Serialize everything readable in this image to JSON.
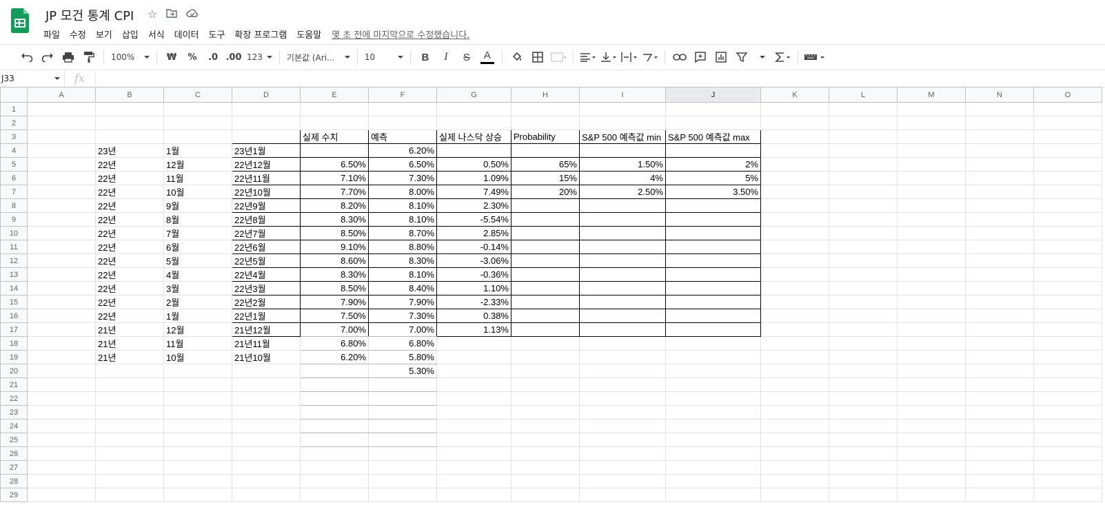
{
  "app": {
    "doc_title": "JP 모건 통계 CPI",
    "menu": [
      "파일",
      "수정",
      "보기",
      "삽입",
      "서식",
      "데이터",
      "도구",
      "확장 프로그램",
      "도움말"
    ],
    "last_edit": "몇 초 전에 마지막으로 수정했습니다.",
    "brand_color": "#0f9d58"
  },
  "toolbar": {
    "zoom": "100%",
    "currency": "₩",
    "percent": "%",
    "decimal_decrease": ".0",
    "decimal_increase": ".00",
    "format_more": "123",
    "font": "기본값 (Ari...",
    "font_size": "10",
    "bold": "B",
    "italic": "I",
    "strike": "S",
    "text_color": "A"
  },
  "formula_bar": {
    "cell_ref": "J33",
    "fx": "fx",
    "value": ""
  },
  "grid": {
    "columns": [
      "A",
      "B",
      "C",
      "D",
      "E",
      "F",
      "G",
      "H",
      "I",
      "J",
      "K",
      "L",
      "M",
      "N",
      "O"
    ],
    "selected_column": "J",
    "row_count": 29,
    "header_row": {
      "E": "실제 수치",
      "F": "예측",
      "G": "실제 나스닥 상승",
      "H": "Probability",
      "I": "S&P 500 예측값 min",
      "J": "S&P 500 예측값 max"
    },
    "rows": [
      {
        "B": "23년",
        "C": "1월",
        "D": "23년1월",
        "E": "",
        "F": "6.20%",
        "G": "",
        "H": "",
        "I": "",
        "J": ""
      },
      {
        "B": "22년",
        "C": "12월",
        "D": "22년12월",
        "E": "6.50%",
        "F": "6.50%",
        "G": "0.50%",
        "H": "65%",
        "I": "1.50%",
        "J": "2%"
      },
      {
        "B": "22년",
        "C": "11월",
        "D": "22년11월",
        "E": "7.10%",
        "F": "7.30%",
        "G": "1.09%",
        "H": "15%",
        "I": "4%",
        "J": "5%"
      },
      {
        "B": "22년",
        "C": "10월",
        "D": "22년10월",
        "E": "7.70%",
        "F": "8.00%",
        "G": "7.49%",
        "H": "20%",
        "I": "2.50%",
        "J": "3.50%"
      },
      {
        "B": "22년",
        "C": "9월",
        "D": "22년9월",
        "E": "8.20%",
        "F": "8.10%",
        "G": "2.30%",
        "H": "",
        "I": "",
        "J": ""
      },
      {
        "B": "22년",
        "C": "8월",
        "D": "22년8월",
        "E": "8.30%",
        "F": "8.10%",
        "G": "-5.54%",
        "H": "",
        "I": "",
        "J": ""
      },
      {
        "B": "22년",
        "C": "7월",
        "D": "22년7월",
        "E": "8.50%",
        "F": "8.70%",
        "G": "2.85%",
        "H": "",
        "I": "",
        "J": ""
      },
      {
        "B": "22년",
        "C": "6월",
        "D": "22년6월",
        "E": "9.10%",
        "F": "8.80%",
        "G": "-0.14%",
        "H": "",
        "I": "",
        "J": ""
      },
      {
        "B": "22년",
        "C": "5월",
        "D": "22년5월",
        "E": "8.60%",
        "F": "8.30%",
        "G": "-3.06%",
        "H": "",
        "I": "",
        "J": ""
      },
      {
        "B": "22년",
        "C": "4월",
        "D": "22년4월",
        "E": "8.30%",
        "F": "8.10%",
        "G": "-0.36%",
        "H": "",
        "I": "",
        "J": ""
      },
      {
        "B": "22년",
        "C": "3월",
        "D": "22년3월",
        "E": "8.50%",
        "F": "8.40%",
        "G": "1.10%",
        "H": "",
        "I": "",
        "J": ""
      },
      {
        "B": "22년",
        "C": "2월",
        "D": "22년2월",
        "E": "7.90%",
        "F": "7.90%",
        "G": "-2.33%",
        "H": "",
        "I": "",
        "J": ""
      },
      {
        "B": "22년",
        "C": "1월",
        "D": "22년1월",
        "E": "7.50%",
        "F": "7.30%",
        "G": "0.38%",
        "H": "",
        "I": "",
        "J": ""
      },
      {
        "B": "21년",
        "C": "12월",
        "D": "21년12월",
        "E": "7.00%",
        "F": "7.00%",
        "G": "1.13%",
        "H": "",
        "I": "",
        "J": ""
      },
      {
        "B": "21년",
        "C": "11월",
        "D": "21년11월",
        "E": "6.80%",
        "F": "6.80%",
        "G": "",
        "H": "",
        "I": "",
        "J": ""
      },
      {
        "B": "21년",
        "C": "10월",
        "D": "21년10월",
        "E": "6.20%",
        "F": "5.80%",
        "G": "",
        "H": "",
        "I": "",
        "J": ""
      },
      {
        "B": "",
        "C": "",
        "D": "",
        "E": "",
        "F": "5.30%",
        "G": "",
        "H": "",
        "I": "",
        "J": ""
      }
    ],
    "e_colors": [
      "",
      "",
      "blue",
      "blue",
      "red",
      "red",
      "blue",
      "red",
      "red",
      "red",
      "red",
      "",
      "red",
      "",
      "",
      "red",
      ""
    ],
    "colors": {
      "red": "#ff0000",
      "blue": "#1c7ed6"
    }
  }
}
